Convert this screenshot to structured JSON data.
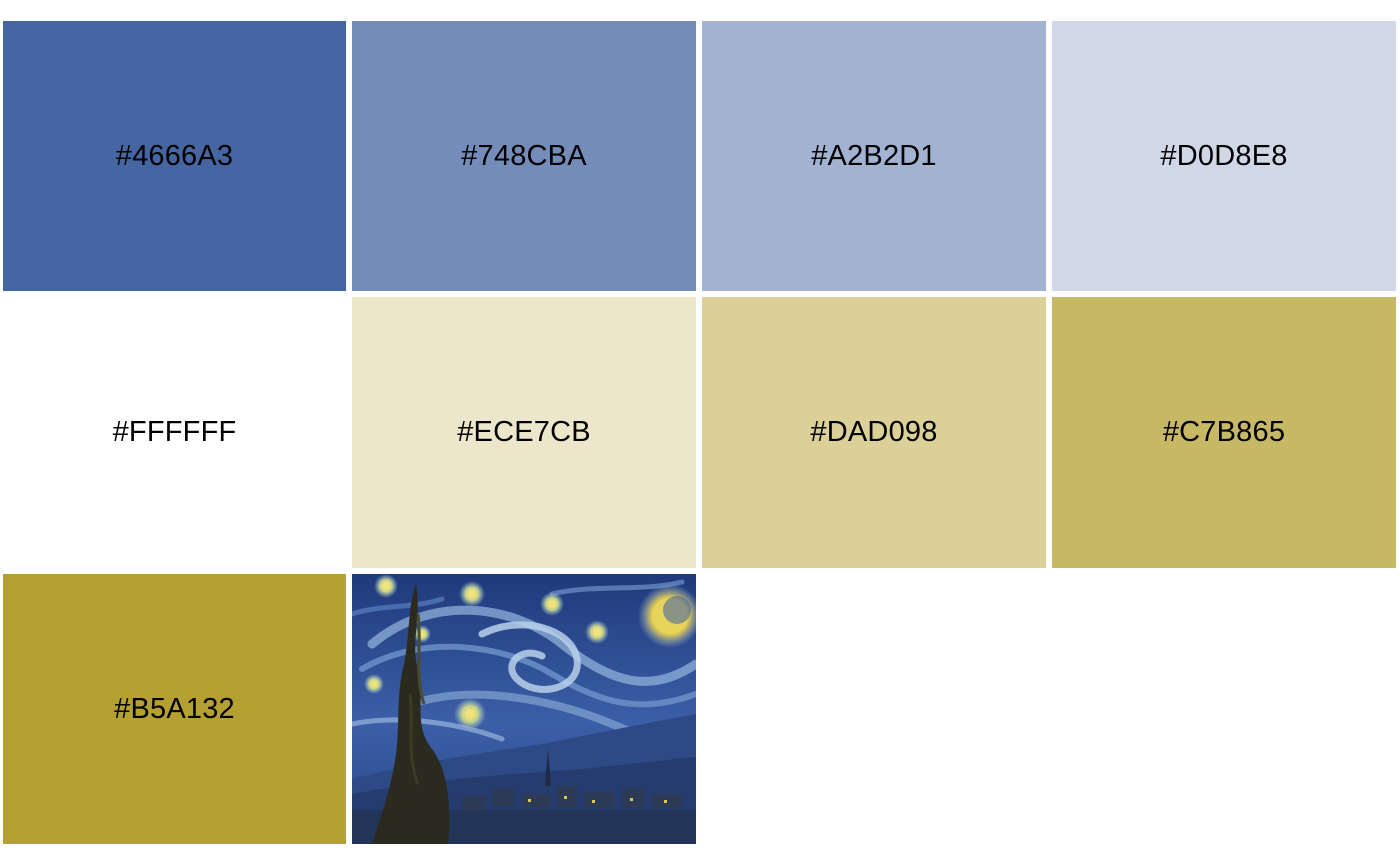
{
  "palette": {
    "swatches": [
      {
        "label": "#4666A3",
        "color": "#4666A3"
      },
      {
        "label": "#748CBA",
        "color": "#748CBA"
      },
      {
        "label": "#A2B2D1",
        "color": "#A2B2D1"
      },
      {
        "label": "#D0D8E8",
        "color": "#D0D8E8"
      },
      {
        "label": "#FFFFFF",
        "color": "#FFFFFF"
      },
      {
        "label": "#ECE7CB",
        "color": "#ECE7CB"
      },
      {
        "label": "#DAD098",
        "color": "#DAD098"
      },
      {
        "label": "#C7B865",
        "color": "#C7B865"
      },
      {
        "label": "#B5A132",
        "color": "#B5A132"
      }
    ],
    "thumbnail": {
      "icon": "starry-night-painting",
      "colors": {
        "sky_dark": "#1f3a7a",
        "sky_mid": "#3b5fa8",
        "sky_light": "#8fb0d8",
        "star_yellow": "#e8d45a",
        "cypress": "#2b2a1e",
        "village": "#2d3a55"
      }
    }
  }
}
